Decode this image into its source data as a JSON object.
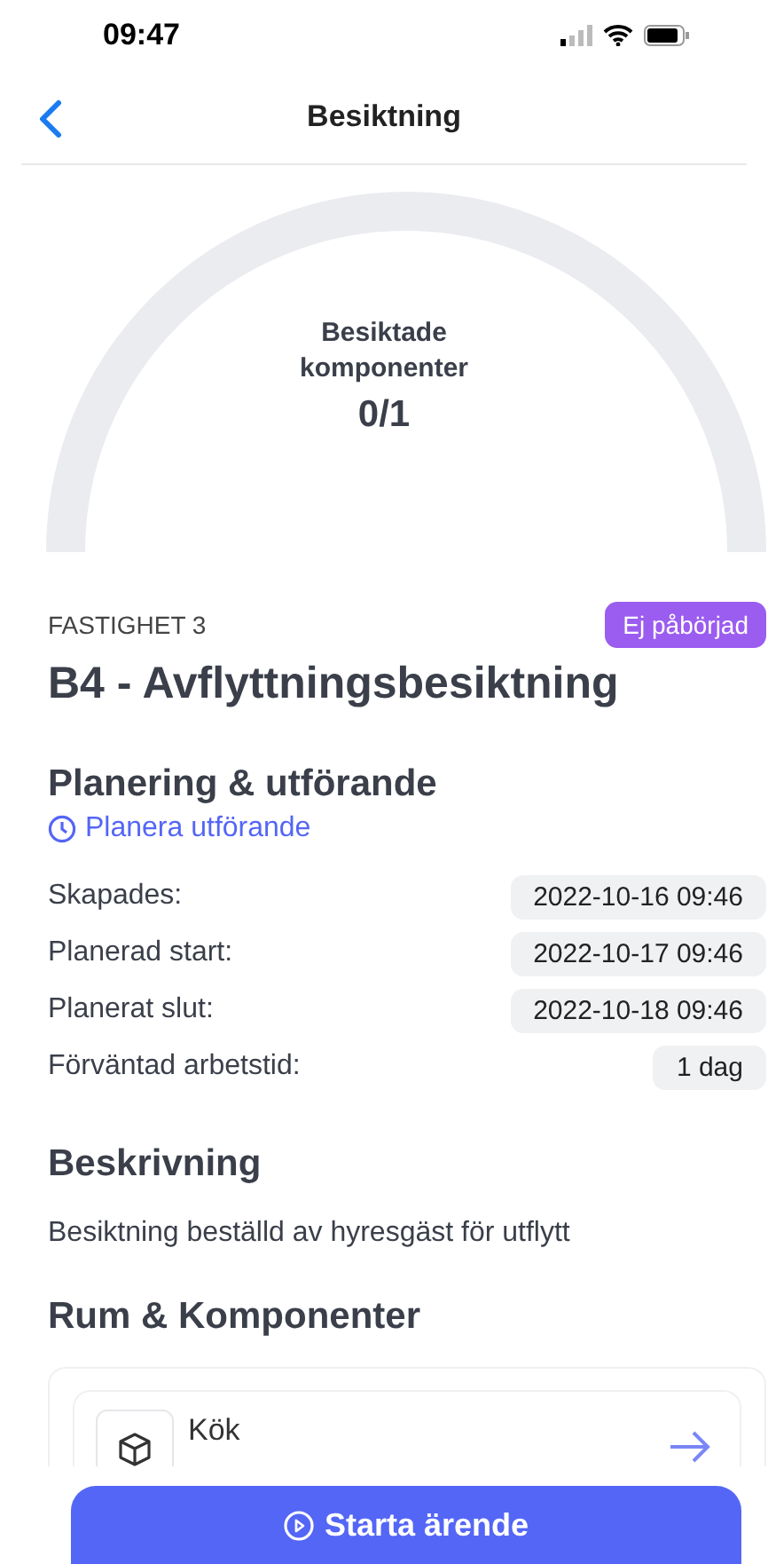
{
  "status_bar": {
    "time": "09:47"
  },
  "nav": {
    "title": "Besiktning"
  },
  "gauge": {
    "label": "Besiktade komponenter",
    "value": "0/1"
  },
  "property": "FASTIGHET 3",
  "status_badge": {
    "label": "Ej påbörjad",
    "color": "#9b5cf0"
  },
  "title": "B4 - Avflyttningsbesiktning",
  "planning": {
    "heading": "Planering & utförande",
    "link": "Planera utförande",
    "rows": [
      {
        "label": "Skapades:",
        "value": "2022-10-16 09:46"
      },
      {
        "label": "Planerad start:",
        "value": "2022-10-17 09:46"
      },
      {
        "label": "Planerat slut:",
        "value": "2022-10-18 09:46"
      },
      {
        "label": "Förväntad arbetstid:",
        "value": "1 dag"
      }
    ]
  },
  "description": {
    "heading": "Beskrivning",
    "text": "Besiktning beställd av hyresgäst för utflytt"
  },
  "rooms": {
    "heading": "Rum & Komponenter",
    "items": [
      {
        "name": "Kök"
      }
    ]
  },
  "action_button": {
    "label": "Starta ärende"
  }
}
